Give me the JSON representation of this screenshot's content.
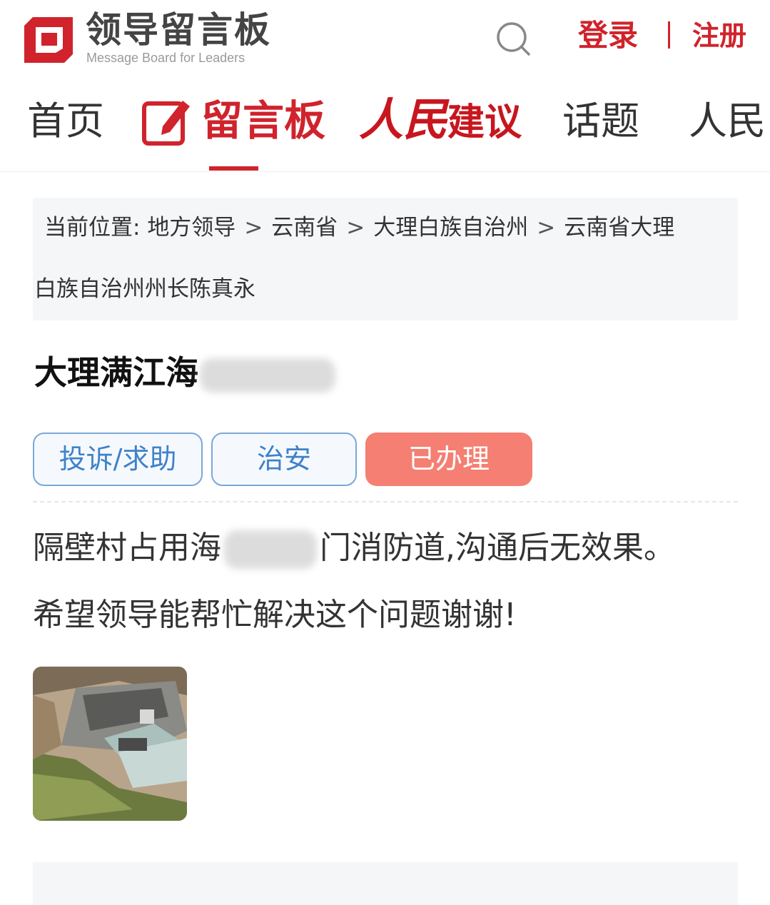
{
  "header": {
    "logo_title": "领导留言板",
    "logo_subtitle": "Message Board for Leaders",
    "login_label": "登录",
    "register_label": "注册",
    "brand_color": "#d0232c"
  },
  "nav": {
    "items": [
      {
        "label": "首页"
      },
      {
        "label": "留言板",
        "active": true
      },
      {
        "label_main": "人民",
        "label_suffix": "建议"
      },
      {
        "label": "话题"
      },
      {
        "label": "人民"
      }
    ]
  },
  "breadcrumb": {
    "prefix": "当前位置:",
    "items": [
      "地方领导",
      "云南省",
      "大理白族自治州"
    ],
    "leader_part1": "云南省大理",
    "leader_part2": "白族自治州州长陈真永",
    "separator": ">"
  },
  "message": {
    "title_visible": "大理满江海",
    "tags": {
      "type": "投诉/求助",
      "category": "治安",
      "status": "已办理",
      "status_color": "#f47f72"
    },
    "content_line1_before": "隔壁村占用海",
    "content_line1_after": "门消防道,沟通后无效果。",
    "content_line2": "希望领导能帮忙解决这个问题谢谢!"
  }
}
